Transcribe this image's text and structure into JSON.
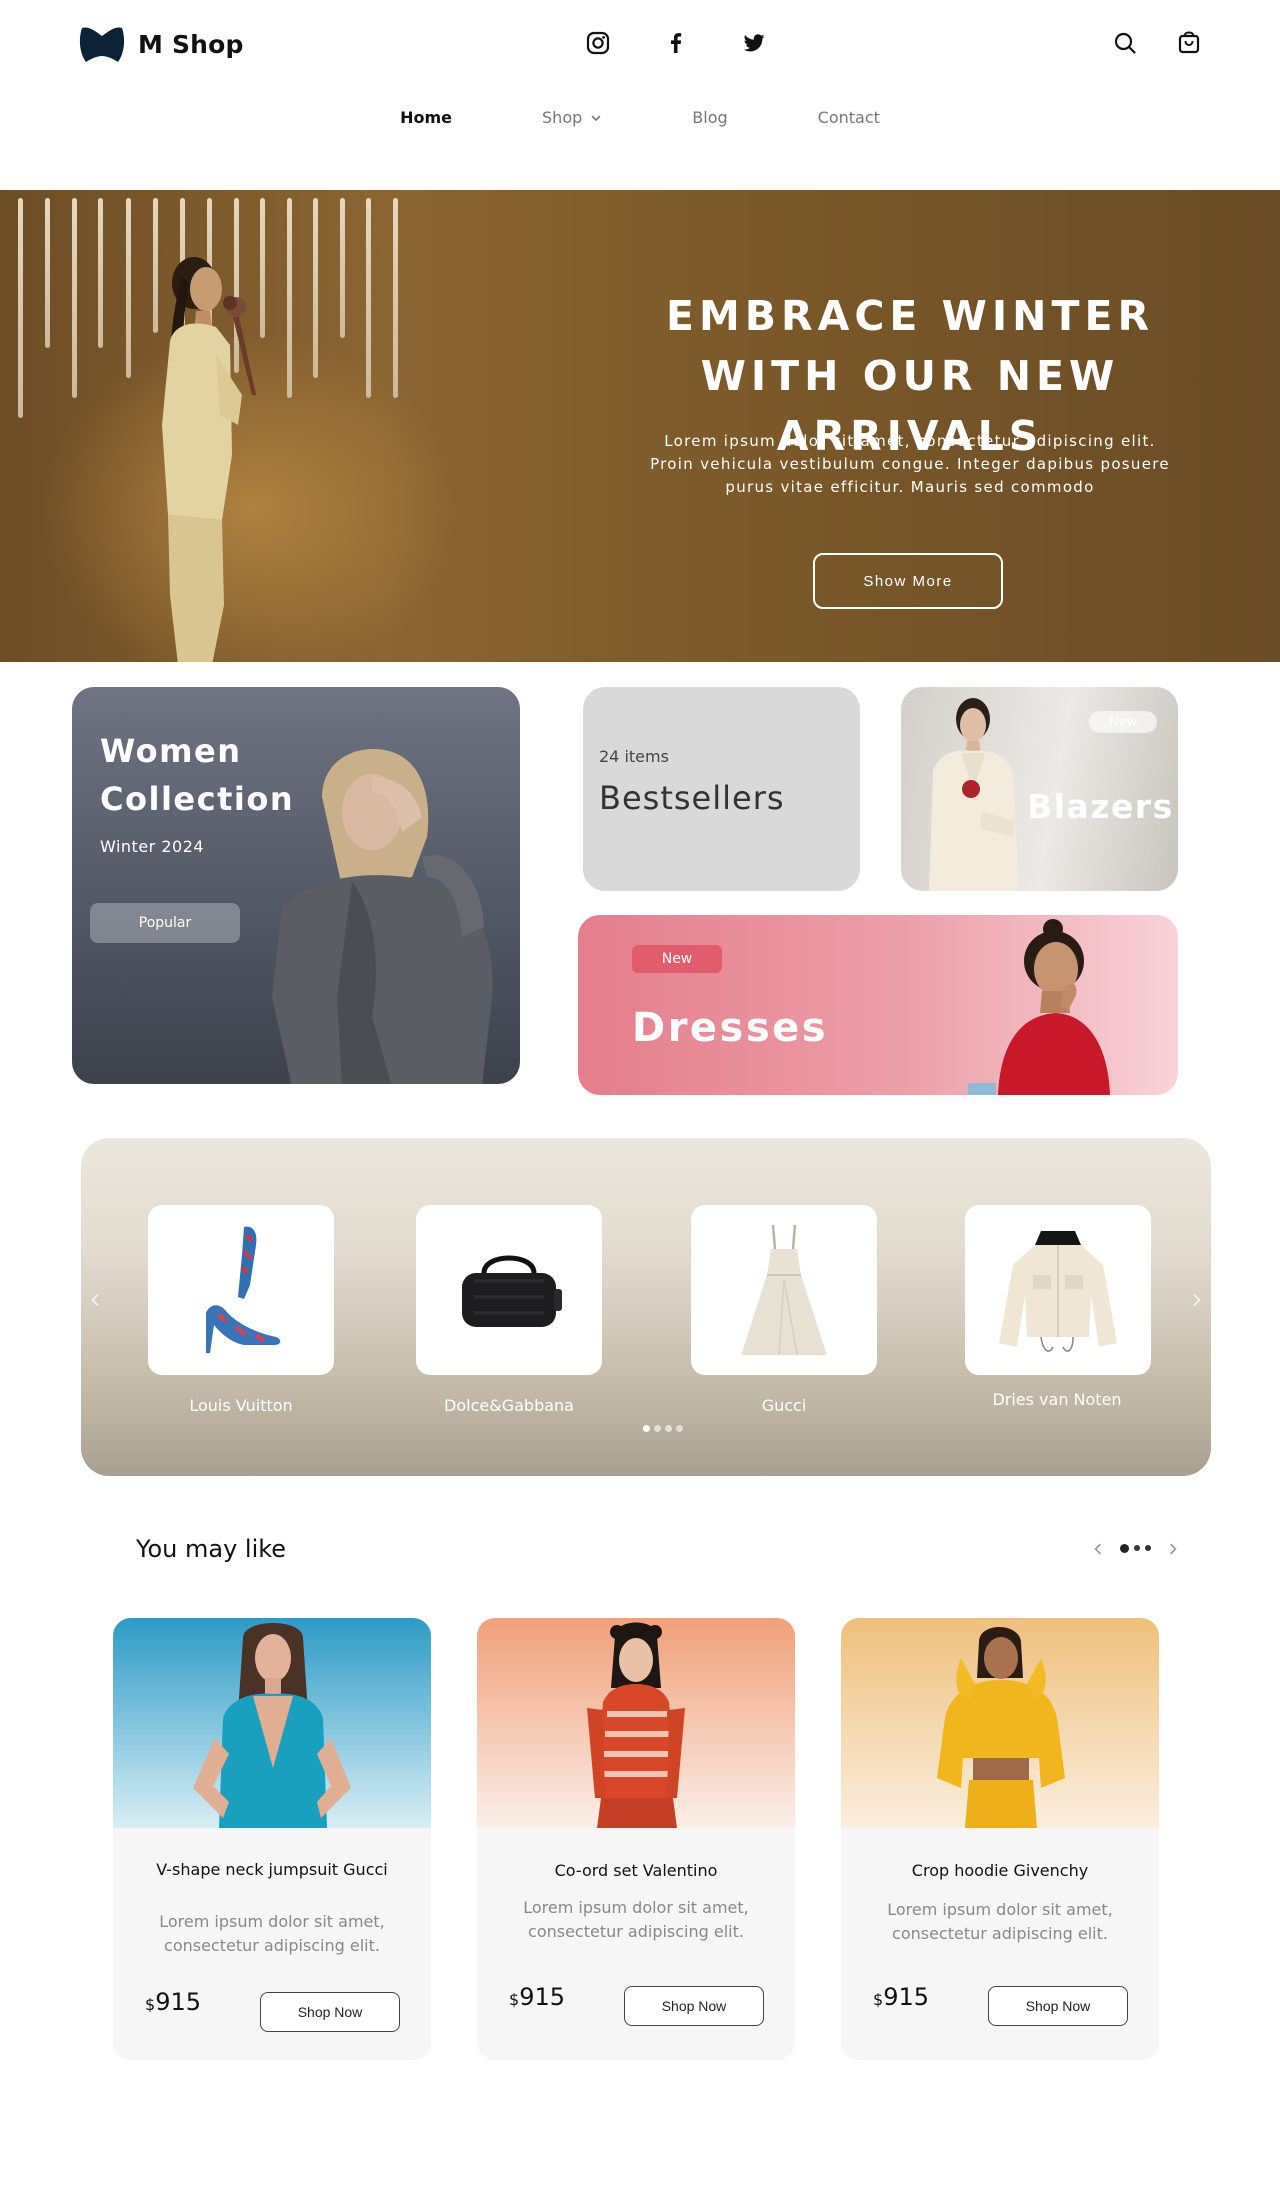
{
  "header": {
    "brand": "M Shop",
    "socials": [
      {
        "icon": "instagram-icon"
      },
      {
        "icon": "facebook-icon"
      },
      {
        "icon": "twitter-icon"
      }
    ],
    "utility": [
      {
        "icon": "search-icon"
      },
      {
        "icon": "shopping-bag-icon"
      }
    ]
  },
  "nav": {
    "items": [
      "Home",
      "Shop",
      "Blog",
      "Contact"
    ],
    "active": "Home"
  },
  "hero": {
    "title": "EMBRACE WINTER WITH OUR NEW ARRIVALS",
    "text": "Lorem ipsum dolor sit amet, consectetur adipiscing elit. Proin vehicula vestibulum congue. Integer dapibus posuere purus vitae efficitur. Mauris sed commodo",
    "button": "Show More"
  },
  "categories": {
    "women": {
      "title": "Women Collection",
      "subtitle": "Winter 2024",
      "badge": "Popular"
    },
    "bestsellers": {
      "count": "24 items",
      "title": "Bestsellers"
    },
    "blazers": {
      "badge": "New",
      "title": "Blazers"
    },
    "dresses": {
      "badge": "New",
      "title": "Dresses"
    }
  },
  "brands": {
    "items": [
      {
        "name": "Louis Vuitton",
        "product": "heels"
      },
      {
        "name": "Dolce&Gabbana",
        "product": "duffel-bag"
      },
      {
        "name": "Gucci",
        "product": "dress"
      },
      {
        "name": "Dries van Noten",
        "product": "jacket"
      }
    ],
    "dots": 4,
    "active_dot": 1
  },
  "recommendations": {
    "title": "You may like",
    "dots": 3,
    "active_dot": 1,
    "products": [
      {
        "name": "V-shape neck jumpsuit Gucci",
        "desc": "Lorem ipsum dolor sit amet, consectetur adipiscing elit.",
        "currency": "$",
        "price": "915",
        "button": "Shop Now"
      },
      {
        "name": "Co-ord set Valentino",
        "desc": "Lorem ipsum dolor sit amet, consectetur adipiscing elit.",
        "currency": "$",
        "price": "915",
        "button": "Shop Now"
      },
      {
        "name": "Crop hoodie Givenchy",
        "desc": "Lorem ipsum dolor sit amet, consectetur adipiscing elit.",
        "currency": "$",
        "price": "915",
        "button": "Shop Now"
      }
    ]
  },
  "colors": {
    "hero_bg": "#7a5829",
    "women_card": "#535865",
    "bestsellers_card": "#d9d9d9",
    "dresses_card": "#ec9fa9",
    "dresses_badge": "#e15c6d"
  }
}
